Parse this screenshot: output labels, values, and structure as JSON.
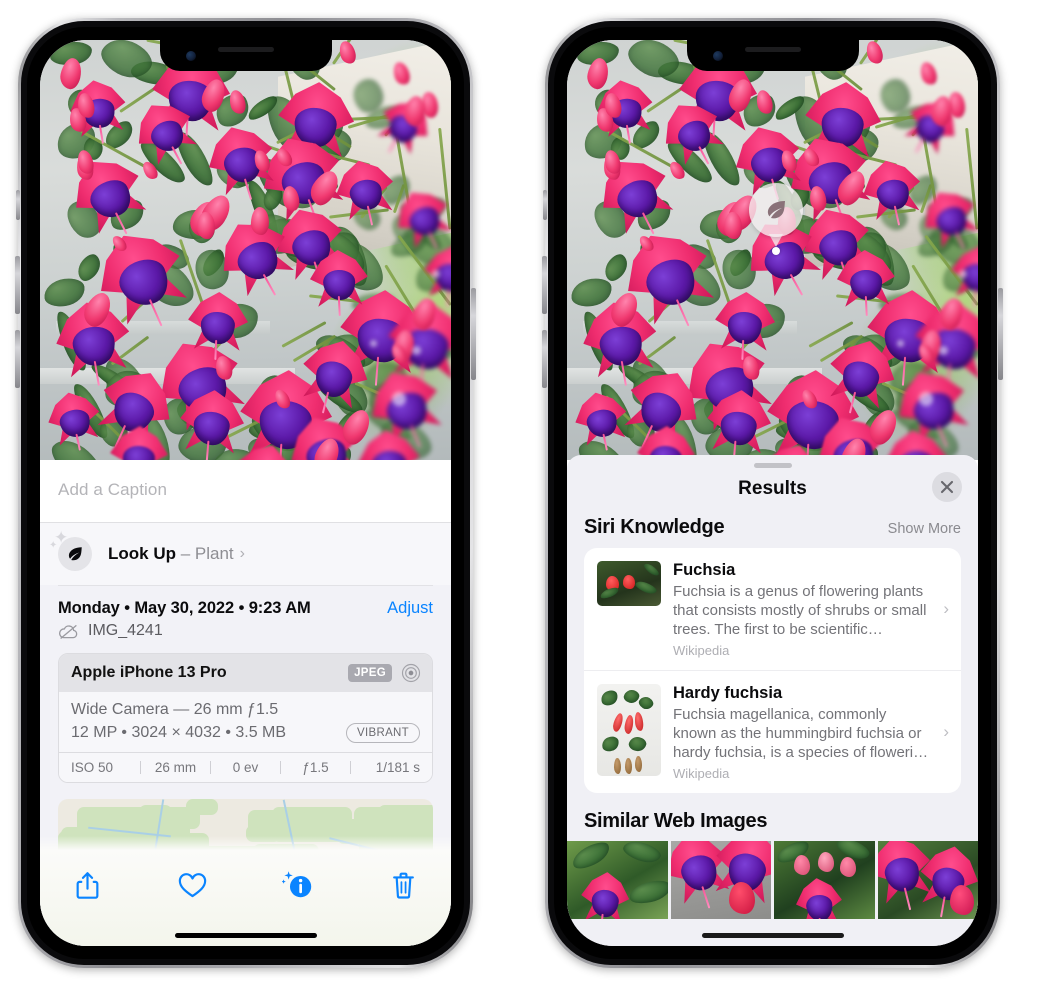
{
  "left_phone": {
    "caption": {
      "placeholder": "Add a Caption",
      "value": ""
    },
    "lookup": {
      "label": "Look Up",
      "dash": " – ",
      "subject": "Plant",
      "chevron": "›",
      "icon": "leaf-icon"
    },
    "metadata": {
      "date": "Monday • May 30, 2022 • 9:23 AM",
      "adjust_label": "Adjust",
      "filename": "IMG_4241",
      "cloud_icon": "icloud-slash-icon"
    },
    "exif": {
      "model": "Apple iPhone 13 Pro",
      "format_badge": "JPEG",
      "hdr_icon": "aperture-icon",
      "lens_line": "Wide Camera — 26 mm ƒ1.5",
      "resolution_line": "12 MP • 3024 × 4032 • 3.5 MB",
      "style_badge": "VIBRANT",
      "settings": [
        "ISO 50",
        "26 mm",
        "0 ev",
        "ƒ1.5",
        "1/181 s"
      ]
    },
    "toolbar": {
      "share_label": "Share",
      "favorite_label": "Favorite",
      "info_label": "Info",
      "delete_label": "Delete"
    }
  },
  "right_phone": {
    "badge": {
      "icon": "leaf-icon",
      "label": "Visual Look Up"
    },
    "sheet": {
      "title": "Results",
      "close_label": "Close",
      "sections": [
        {
          "title": "Siri Knowledge",
          "action": "Show More",
          "items": [
            {
              "title": "Fuchsia",
              "description": "Fuchsia is a genus of flowering plants that consists mostly of shrubs or small trees. The first to be scientific…",
              "source": "Wikipedia",
              "chevron": "›"
            },
            {
              "title": "Hardy fuchsia",
              "description": "Fuchsia magellanica, commonly known as the hummingbird fuchsia or hardy fuchsia, is a species of floweri…",
              "source": "Wikipedia",
              "chevron": "›"
            }
          ]
        },
        {
          "title": "Similar Web Images",
          "action": "",
          "thumbnails": [
            "fuchsia-web-image-1",
            "fuchsia-web-image-2",
            "fuchsia-web-image-3",
            "fuchsia-web-image-4"
          ]
        }
      ]
    }
  },
  "colors": {
    "accent_blue": "#0a84ff",
    "sheet_bg": "#f2f2f7",
    "results_bg": "#f0f0f5",
    "card_white": "#ffffff",
    "secondary_text": "#8e8e93"
  }
}
